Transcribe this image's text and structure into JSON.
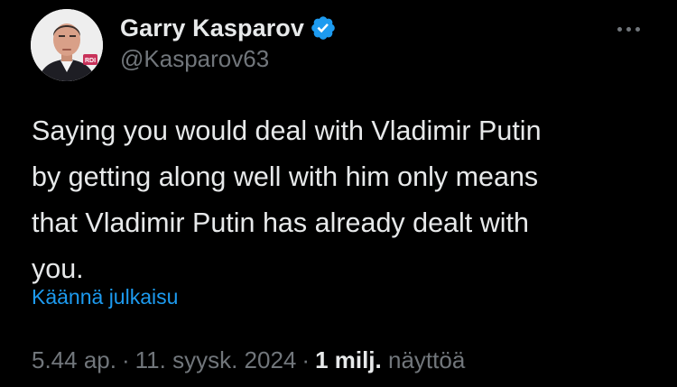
{
  "tweet": {
    "author": {
      "display_name": "Garry Kasparov",
      "handle": "@Kasparov63",
      "verified": true,
      "avatar_badge_text": "RDI"
    },
    "text": "Saying you would deal with Vladimir Putin\nby getting along well with him only means\nthat Vladimir Putin has already dealt with\nyou.",
    "translate_label": "Käännä julkaisu",
    "time": "5.44 ap.",
    "date": "11. syysk. 2024",
    "separator": "·",
    "views_count": "1 milj.",
    "views_label": "näyttöä",
    "more_menu_icon": "more-horizontal-icon"
  },
  "colors": {
    "background": "#000000",
    "primary_text": "#e7e9ea",
    "secondary_text": "#71767b",
    "link": "#1d9bf0",
    "verified_badge": "#1d9bf0"
  }
}
